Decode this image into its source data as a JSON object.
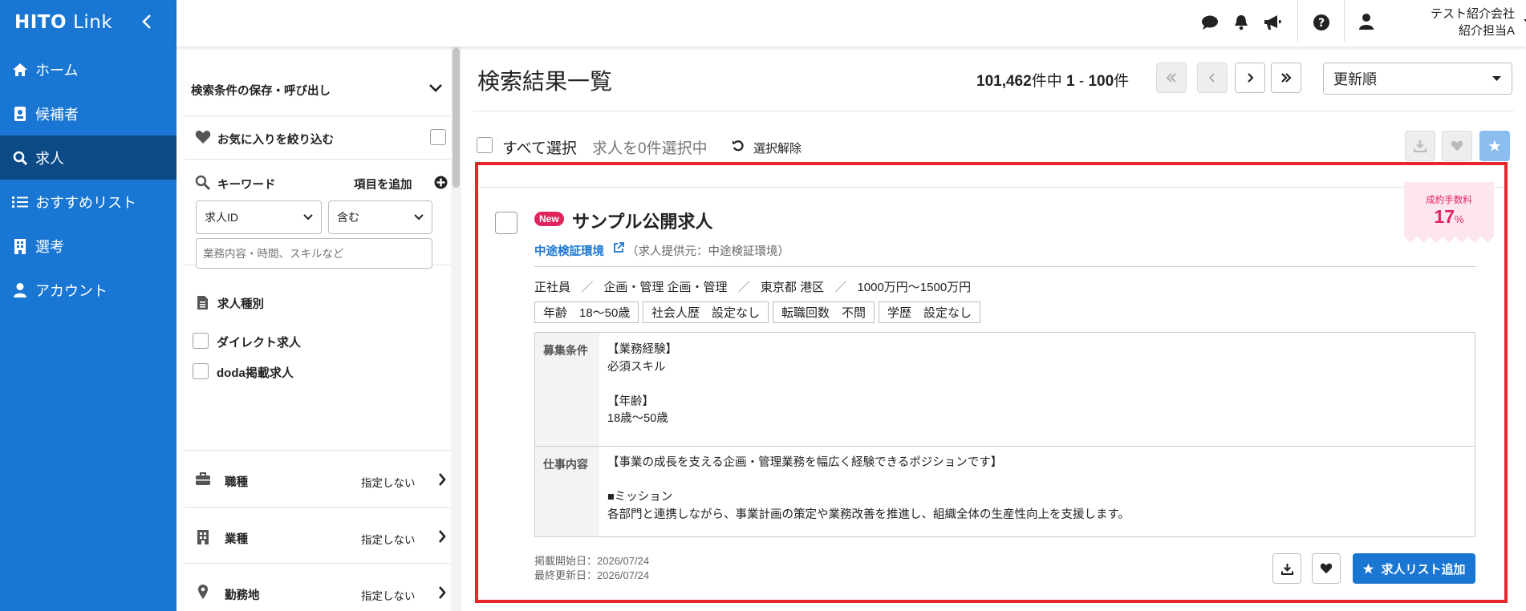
{
  "brand": {
    "logo_bold": "HITO",
    "logo_light": "Link"
  },
  "nav": {
    "home": "ホーム",
    "candidates": "候補者",
    "jobs": "求人",
    "recommend": "おすすめリスト",
    "selection": "選考",
    "account": "アカウント"
  },
  "header": {
    "company": "テスト紹介会社",
    "person": "紹介担当A"
  },
  "filter": {
    "saved": "検索条件の保存・呼び出し",
    "favorites": "お気に入りを絞り込む",
    "keyword": "キーワード",
    "add_item": "項目を追加",
    "field_select": "求人ID",
    "match_select": "含む",
    "keyword_placeholder": "業務内容・時間、スキルなど",
    "job_type": "求人種別",
    "direct": "ダイレクト求人",
    "doda": "doda掲載求人",
    "occupation": "職種",
    "industry": "業種",
    "location": "勤務地",
    "unspecified": "指定しない"
  },
  "results": {
    "title": "検索結果一覧",
    "total": "101,462",
    "of_label": "件中",
    "range_start": "1",
    "range_sep": "-",
    "range_end": "100",
    "range_unit": "件",
    "sort": "更新順",
    "select_all": "すべて選択",
    "selected_count": "求人を0件選択中",
    "clear": "選択解除"
  },
  "job": {
    "new_badge": "New",
    "title": "サンプル公開求人",
    "provider_link": "中途検証環境",
    "provider_note": "（求人提供元：中途検証環境）",
    "fee_label": "成約手数料",
    "fee_value": "17",
    "fee_unit": "%",
    "meta": {
      "employment": "正社員",
      "sep": "／",
      "category": "企画・管理 企画・管理",
      "location": "東京都 港区",
      "salary": "1000万円〜1500万円"
    },
    "tags": [
      "年齢　18〜50歳",
      "社会人歴　設定なし",
      "転職回数　不問",
      "学歴　設定なし"
    ],
    "conditions_label": "募集条件",
    "conditions": [
      "【業務経験】",
      "必須スキル",
      "",
      "【年齢】",
      "18歳〜50歳"
    ],
    "work_label": "仕事内容",
    "work": [
      "【事業の成長を支える企画・管理業務を幅広く経験できるポジションです】",
      "",
      "■ミッション",
      "各部門と連携しながら、事業計画の策定や業務改善を推進し、組織全体の生産性向上を支援します。"
    ],
    "posted": "掲載開始日：2026/07/24",
    "updated": "最終更新日：2026/07/24",
    "add_list": "求人リスト追加"
  },
  "colors": {
    "sidebar": "#1976d2",
    "sidebar_active": "#0c4a86",
    "accent": "#1976d2",
    "highlight": "#e8242d",
    "new": "#e0245e",
    "fee": "#e0245e"
  }
}
